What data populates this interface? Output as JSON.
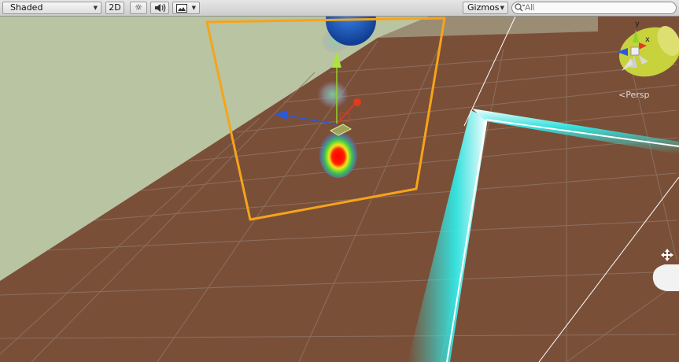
{
  "toolbar": {
    "shading_mode": "Shaded",
    "mode_2d": "2D",
    "gizmos_label": "Gizmos",
    "search_placeholder": "All",
    "icons": [
      "dropdown-arrow-icon",
      "scene-lighting-icon",
      "audio-icon",
      "effects-image-icon",
      "search-icon"
    ]
  },
  "scene": {
    "camera_label": "Persp",
    "orientation_axes": {
      "y": "y",
      "x": "x"
    },
    "colors": {
      "floor": "#7a4f38",
      "wall": "#b9c4a2",
      "grid": "#8e7566",
      "selection_outline": "#f5a41a",
      "boundary_glow": "#2ef1ef",
      "sphere": "#1f5fc4",
      "axis_y": "#8ed52a",
      "axis_x": "#e03a1f",
      "axis_z": "#2a58e0",
      "gizmo_cone": "#c8d23c"
    }
  }
}
